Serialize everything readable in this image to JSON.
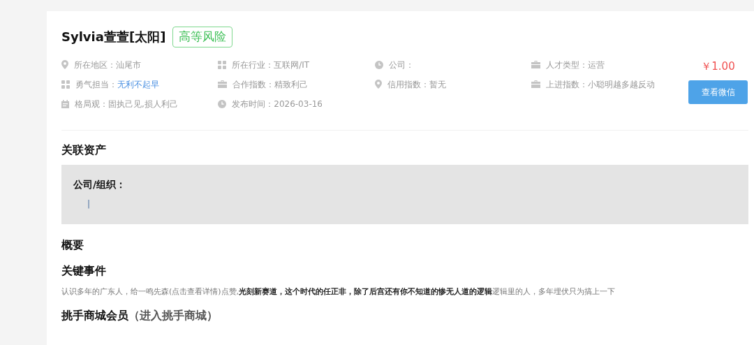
{
  "profile": {
    "name": "Sylvia萱萱[太阳]",
    "risk_badge": "高等风险",
    "price": "￥1.00",
    "button": "查看微信"
  },
  "info": [
    {
      "label": "所在地区：",
      "value": "汕尾市",
      "link": false
    },
    {
      "label": "所在行业：",
      "value": "互联网/IT",
      "link": false
    },
    {
      "label": "公司："
    },
    {
      "label": "人才类型：",
      "value": "运营",
      "link": false
    },
    {
      "label": "勇气担当：",
      "value": "无利不起早",
      "link": true
    },
    {
      "label": "合作指数：",
      "value": "精致利己",
      "link": false
    },
    {
      "label": "信用指数：",
      "value": "暂无",
      "link": false
    },
    {
      "label": "上进指数：",
      "value": "小聪明越多越反动",
      "link": false
    },
    {
      "label": "格局观：",
      "value": "固执己见,损人利己",
      "link": false
    },
    {
      "label": "发布时间：",
      "value": "2026-03-16",
      "link": false
    }
  ],
  "assets": {
    "heading": "关联资产",
    "label": "公司/组织：",
    "entry": "|"
  },
  "summary": {
    "heading": "概要"
  },
  "events": {
    "heading": "关键事件",
    "text": "认识多年的广东人，给一鸣先森(点击查看详情)点赞,**光刻新赛道，这个时代的任正非，除了后宫还有你不知道的惨无人道的逻辑**逻辑里的人，多年埋伏只为搞上一下"
  },
  "membership": {
    "heading": "挑手商城会员",
    "link": "（进入挑手商城）"
  }
}
